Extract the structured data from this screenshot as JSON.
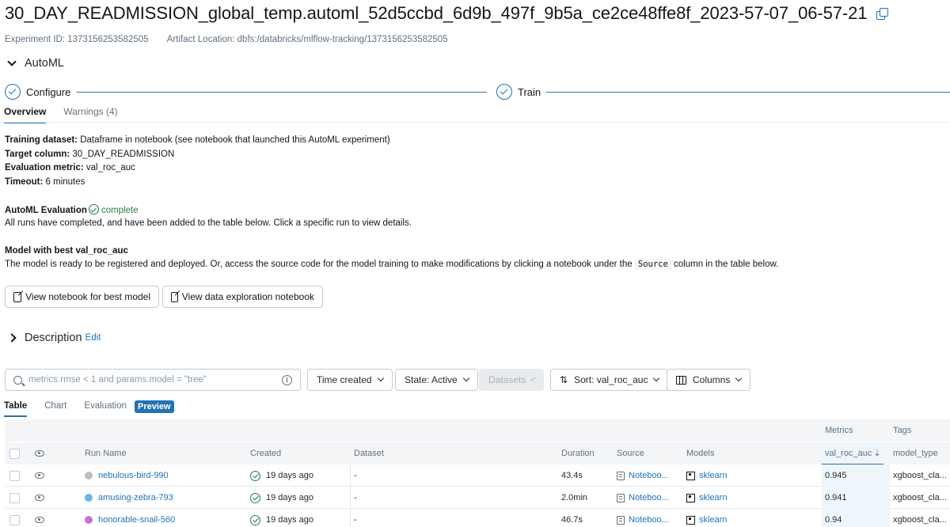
{
  "header": {
    "title": "30_DAY_READMISSION_global_temp.automl_52d5ccbd_6d9b_497f_9b5a_ce2ce48ffe8f_2023-57-07_06-57-21",
    "experiment_id": "Experiment ID: 1373156253582505",
    "artifact_location": "Artifact Location: dbfs:/databricks/mlflow-tracking/1373156253582505"
  },
  "automl": {
    "label": "AutoML",
    "steps": [
      "Configure",
      "Train"
    ],
    "tabs": [
      "Overview",
      "Warnings (4)"
    ],
    "training_dataset_label": "Training dataset:",
    "training_dataset_value": " Dataframe in notebook (see notebook that launched this AutoML experiment)",
    "target_column_label": "Target column:",
    "target_column_value": " 30_DAY_READMISSION",
    "eval_metric_label": "Evaluation metric:",
    "eval_metric_value": " val_roc_auc",
    "timeout_label": "Timeout:",
    "timeout_value": " 6 minutes",
    "evaluation_label": "AutoML Evaluation",
    "evaluation_status": "complete",
    "evaluation_text": "All runs have completed, and have been added to the table below. Click a specific run to view details.",
    "best_model_label": "Model with best val_roc_auc",
    "best_model_text_1": "The model is ready to be registered and deployed. Or, access the source code for the model training to make modifications by clicking a notebook under the",
    "best_model_code": "Source",
    "best_model_text_2": "column in the table below.",
    "btn_best_notebook": "View notebook for best model",
    "btn_data_notebook": "View data exploration notebook"
  },
  "description": {
    "label": "Description",
    "edit": "Edit"
  },
  "filters": {
    "search_placeholder": "metrics.rmse < 1 and params.model = \"tree\"",
    "time_created": "Time created",
    "state": "State: Active",
    "datasets": "Datasets",
    "sort": "Sort: val_roc_auc",
    "columns": "Columns"
  },
  "view_tabs": {
    "table": "Table",
    "chart": "Chart",
    "evaluation": "Evaluation",
    "preview_badge": "Preview"
  },
  "table": {
    "group_metrics": "Metrics",
    "group_tags": "Tags",
    "headers": {
      "run_name": "Run Name",
      "created": "Created",
      "dataset": "Dataset",
      "duration": "Duration",
      "source": "Source",
      "models": "Models",
      "metric": "val_roc_auc",
      "tag": "model_type"
    },
    "rows": [
      {
        "color": "#bcbcbc",
        "run_name": "nebulous-bird-990",
        "created": "19 days ago",
        "dataset": "-",
        "duration": "43.4s",
        "source": "Noteboo...",
        "model": "sklearn",
        "metric": "0.945",
        "tag": "xgboost_cla..."
      },
      {
        "color": "#6bb6e2",
        "run_name": "amusing-zebra-793",
        "created": "19 days ago",
        "dataset": "-",
        "duration": "2.0min",
        "source": "Noteboo...",
        "model": "sklearn",
        "metric": "0.941",
        "tag": "xgboost_cla..."
      },
      {
        "color": "#c873cf",
        "run_name": "honorable-snail-560",
        "created": "19 days ago",
        "dataset": "-",
        "duration": "46.7s",
        "source": "Noteboo...",
        "model": "sklearn",
        "metric": "0.94",
        "tag": "xgboost_cla..."
      }
    ]
  }
}
